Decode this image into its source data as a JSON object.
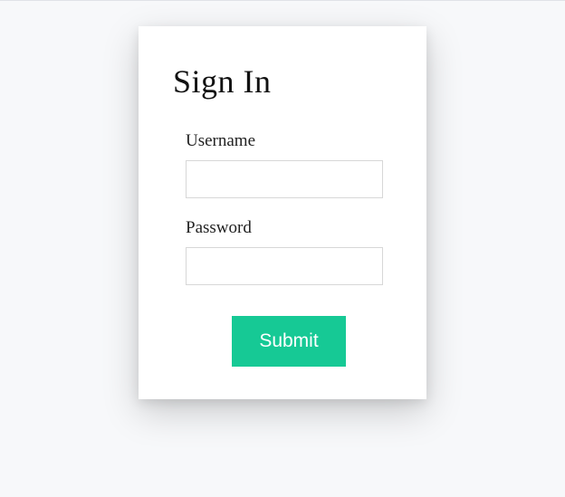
{
  "form": {
    "title": "Sign In",
    "username": {
      "label": "Username",
      "value": ""
    },
    "password": {
      "label": "Password",
      "value": ""
    },
    "submit_label": "Submit"
  },
  "colors": {
    "accent": "#16c995",
    "background": "#f7f8fa",
    "card": "#ffffff",
    "border": "#d7d7d7"
  }
}
